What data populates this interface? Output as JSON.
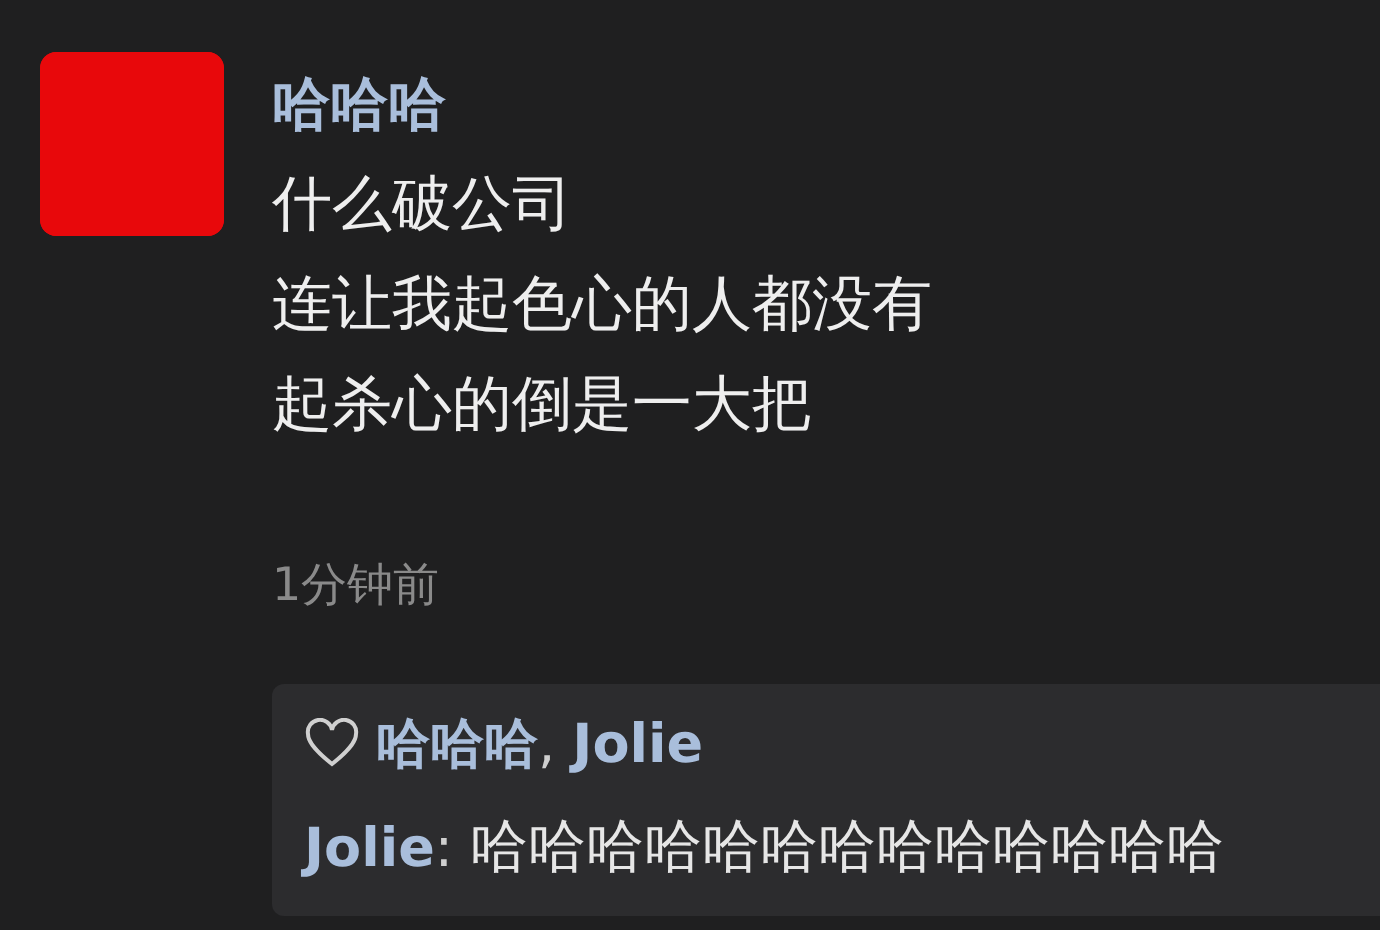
{
  "post": {
    "author": "哈哈哈",
    "lines": [
      "什么破公司",
      "连让我起色心的人都没有",
      "起杀心的倒是一大把"
    ],
    "time": "1分钟前"
  },
  "likes": {
    "names": [
      "哈哈哈",
      "Jolie"
    ],
    "separator": ", "
  },
  "comments": [
    {
      "author": "Jolie",
      "separator": ": ",
      "text": "哈哈哈哈哈哈哈哈哈哈哈哈哈"
    }
  ]
}
